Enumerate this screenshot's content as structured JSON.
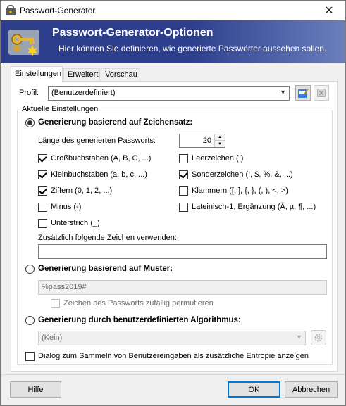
{
  "window": {
    "title": "Passwort-Generator",
    "close_glyph": "✕"
  },
  "banner": {
    "title": "Passwort-Generator-Optionen",
    "subtitle": "Hier können Sie definieren, wie generierte Passwörter aussehen sollen.",
    "icon": "key-generator-icon"
  },
  "tabs": [
    {
      "label": "Einstellungen",
      "active": true
    },
    {
      "label": "Erweitert",
      "active": false
    },
    {
      "label": "Vorschau",
      "active": false
    }
  ],
  "profile": {
    "label": "Profil:",
    "value": "(Benutzerdefiniert)",
    "save_icon": "save-profile-icon",
    "delete_icon": "delete-profile-icon"
  },
  "current_settings": {
    "legend": "Aktuelle Einstellungen",
    "charset_mode": {
      "label": "Generierung basierend auf Zeichensatz:",
      "selected": true,
      "length_label": "Länge des generierten Passworts:",
      "length_value": "20",
      "options_left": [
        {
          "label": "Großbuchstaben (A, B, C, ...)",
          "checked": true
        },
        {
          "label": "Kleinbuchstaben (a, b, c, ...)",
          "checked": true
        },
        {
          "label": "Ziffern (0, 1, 2, ...)",
          "checked": true
        },
        {
          "label": "Minus (-)",
          "checked": false
        },
        {
          "label": "Unterstrich (_)",
          "checked": false
        }
      ],
      "options_right": [
        {
          "label": "Leerzeichen ( )",
          "checked": false
        },
        {
          "label": "Sonderzeichen (!, $, %, &, ...)",
          "checked": true
        },
        {
          "label": "Klammern ([, ], {, }, (, ), <, >)",
          "checked": false
        },
        {
          "label": "Lateinisch-1, Ergänzung (Ä, µ, ¶, ...)",
          "checked": false
        }
      ],
      "extra_label": "Zusätzlich folgende Zeichen verwenden:",
      "extra_value": ""
    },
    "pattern_mode": {
      "label": "Generierung basierend auf Muster:",
      "selected": false,
      "pattern_value": "%pass2019#",
      "permute_label": "Zeichen des Passworts zufällig permutieren",
      "permute_checked": false
    },
    "algorithm_mode": {
      "label": "Generierung durch benutzerdefinierten Algorithmus:",
      "selected": false,
      "value": "(Kein)",
      "options_icon": "gear-icon"
    },
    "entropy": {
      "label": "Dialog zum Sammeln von Benutzereingaben als zusätzliche Entropie anzeigen",
      "checked": false
    }
  },
  "footer": {
    "help": "Hilfe",
    "ok": "OK",
    "cancel": "Abbrechen"
  },
  "colors": {
    "banner": "#2d3f8c",
    "accent": "#0078d7"
  }
}
